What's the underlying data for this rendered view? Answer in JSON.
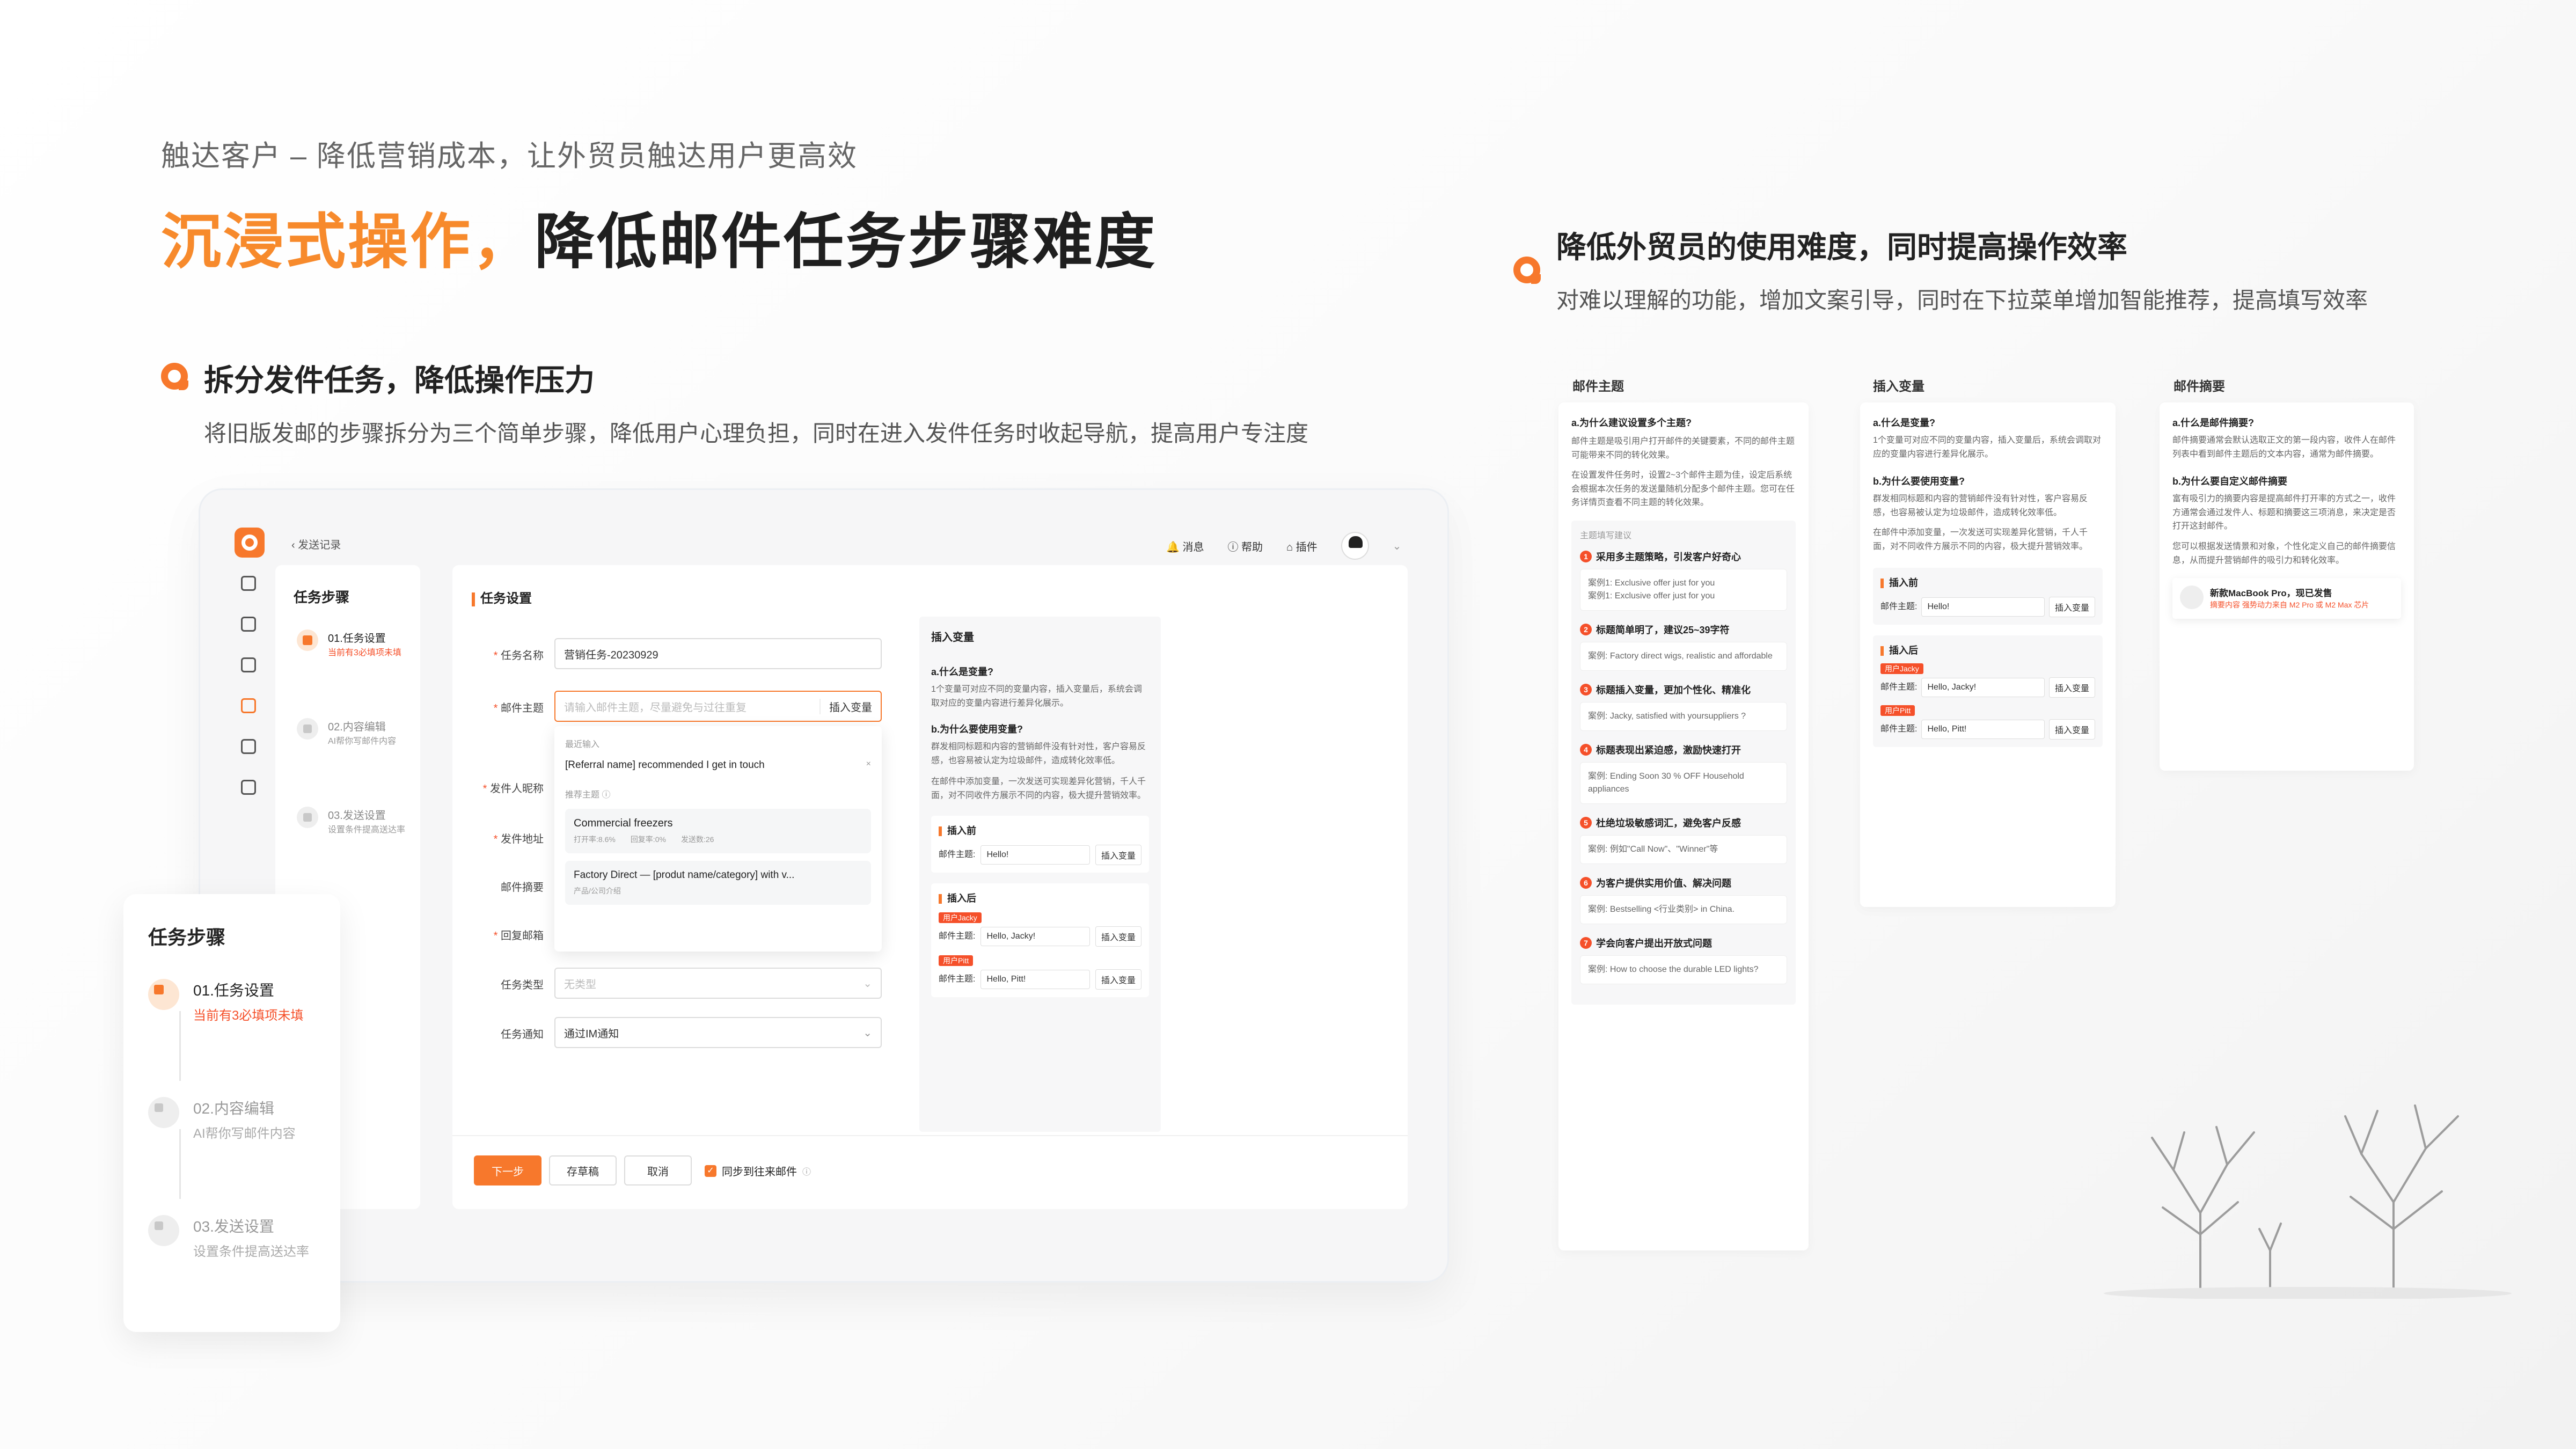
{
  "hero": {
    "eyebrow": "触达客户 – 降低营销成本，让外贸员触达用户更高效",
    "title_highlight": "沉浸式操作，",
    "title_rest": "降低邮件任务步骤难度"
  },
  "section_left": {
    "title": "拆分发件任务，降低操作压力",
    "desc": "将旧版发邮的步骤拆分为三个简单步骤，降低用户心理负担，同时在进入发件任务时收起导航，提高用户专注度"
  },
  "section_right": {
    "title": "降低外贸员的使用难度，同时提高操作效率",
    "desc": "对难以理解的功能，增加文案引导，同时在下拉菜单增加智能推荐，提高填写效率"
  },
  "app": {
    "back_label": "发送记录",
    "nav": {
      "messages": "消息",
      "help": "帮助",
      "plugins": "插件"
    },
    "steps_title": "任务步骤",
    "steps": [
      {
        "title": "01.任务设置",
        "sub": "当前有3必填项未填"
      },
      {
        "title": "02.内容编辑",
        "sub": "AI帮你写邮件内容"
      },
      {
        "title": "03.发送设置",
        "sub": "设置条件提高送达率"
      }
    ],
    "form_title": "任务设置",
    "fields": {
      "task_name_label": "任务名称",
      "task_name_value": "营销任务-20230929",
      "subject_label": "邮件主题",
      "subject_placeholder": "请输入邮件主题，尽量避免与过往重复",
      "insert_var": "插入变量",
      "sender_label": "发件人昵称",
      "sender_addr_label": "发件地址",
      "summary_label": "邮件摘要",
      "reply_label": "回复邮箱",
      "type_label": "任务类型",
      "type_placeholder": "无类型",
      "notify_label": "任务通知",
      "notify_value": "通过IM通知"
    },
    "dropdown": {
      "recent_label": "最近输入",
      "recent_item": "[Referral name] recommended I get in touch",
      "close": "×",
      "recommend_label": "推荐主题",
      "items": [
        {
          "title": "Commercial freezers",
          "meta": [
            "打开率:8.6%",
            "回复率:0%",
            "发送数:26"
          ]
        },
        {
          "title": "Factory Direct — [produt name/category] with v...",
          "meta": [
            "产品/公司介绍"
          ]
        }
      ]
    },
    "help_panel": {
      "title": "插入变量",
      "q1": "a.什么是变量?",
      "a1": "1个变量可对应不同的变量内容，插入变量后，系统会调取对应的变量内容进行差异化展示。",
      "q2": "b.为什么要使用变量?",
      "a2": "群发相同标题和内容的营销邮件没有针对性，客户容易反感，也容易被认定为垃圾邮件，造成转化效率低。",
      "a3": "在邮件中添加变量，一次发送可实现差异化营销，千人千面，对不同收件方展示不同的内容，极大提升营销效率。",
      "before_title": "插入前",
      "after_title": "插入后",
      "subject_label": "邮件主题:",
      "hello": "Hello!",
      "tag1": "用户Jacky",
      "hello_jacky": "Hello, Jacky!",
      "tag2": "用户Pitt",
      "hello_pitt": "Hello, Pitt!"
    },
    "buttons": {
      "next": "下一步",
      "draft": "存草稿",
      "cancel": "取消",
      "sync": "同步到往来邮件"
    }
  },
  "floating_steps": {
    "title": "任务步骤",
    "steps": [
      {
        "title": "01.任务设置",
        "sub": "当前有3必填项未填"
      },
      {
        "title": "02.内容编辑",
        "sub": "AI帮你写邮件内容"
      },
      {
        "title": "03.发送设置",
        "sub": "设置条件提高送达率"
      }
    ]
  },
  "cards": {
    "subject": {
      "head": "邮件主题",
      "q": "a.为什么建议设置多个主题?",
      "p1": "邮件主题是吸引用户打开邮件的关键要素，不同的邮件主题可能带来不同的转化效果。",
      "p2": "在设置发件任务时，设置2~3个邮件主题为佳，设定后系统会根据本次任务的发送量随机分配多个邮件主题。您可在任务详情页查看不同主题的转化效果。",
      "tips_label": "主题填写建议",
      "tips": [
        {
          "n": "1",
          "title": "采用多主题策略，引发客户好奇心",
          "cases": [
            "案例1: Exclusive offer just for you",
            "案例1: Exclusive offer just for you"
          ]
        },
        {
          "n": "2",
          "title": "标题简单明了，建议25~39字符",
          "cases": [
            "案例: Factory direct wigs, realistic and affordable"
          ]
        },
        {
          "n": "3",
          "title": "标题插入变量，更加个性化、精准化",
          "cases": [
            "案例: Jacky, satisfied with yoursuppliers ?"
          ]
        },
        {
          "n": "4",
          "title": "标题表现出紧迫感，激励快速打开",
          "cases": [
            "案例: Ending Soon 30 % OFF Household appliances"
          ]
        },
        {
          "n": "5",
          "title": "杜绝垃圾敏感词汇，避免客户反感",
          "cases": [
            "案例: 例如\"Call Now\"、\"Winner\"等"
          ]
        },
        {
          "n": "6",
          "title": "为客户提供实用价值、解决问题",
          "cases": [
            "案例: Bestselling <行业类别> in China."
          ]
        },
        {
          "n": "7",
          "title": "学会向客户提出开放式问题",
          "cases": [
            "案例: How to choose the durable LED lights?"
          ]
        }
      ]
    },
    "variable": {
      "head": "插入变量",
      "q1": "a.什么是变量?",
      "a1": "1个变量可对应不同的变量内容，插入变量后，系统会调取对应的变量内容进行差异化展示。",
      "q2": "b.为什么要使用变量?",
      "a2": "群发相同标题和内容的营销邮件没有针对性，客户容易反感，也容易被认定为垃圾邮件，造成转化效率低。",
      "a3": "在邮件中添加变量，一次发送可实现差异化营销，千人千面，对不同收件方展示不同的内容，极大提升营销效率。",
      "before": "插入前",
      "after": "插入后",
      "subject_label": "邮件主题:",
      "hello": "Hello!",
      "insert": "插入变量",
      "tag1": "用户Jacky",
      "hello_jacky": "Hello, Jacky!",
      "tag2": "用户Pitt",
      "hello_pitt": "Hello, Pitt!"
    },
    "summary": {
      "head": "邮件摘要",
      "q1": "a.什么是邮件摘要?",
      "a1": "邮件摘要通常会默认选取正文的第一段内容，收件人在邮件列表中看到邮件主题后的文本内容，通常为邮件摘要。",
      "q2": "b.为什么要自定义邮件摘要",
      "a2": "富有吸引力的摘要内容是提高邮件打开率的方式之一，收件方通常会通过发件人、标题和摘要这三项消息，来决定是否打开这封邮件。",
      "a3": "您可以根据发送情景和对象，个性化定义自己的邮件摘要信息，从而提升营销邮件的吸引力和转化效率。",
      "preview_title": "新款MacBook Pro，现已发售",
      "preview_body": "摘要内容 强势动力来自 M2 Pro 或 M2 Max 芯片"
    }
  },
  "colors": {
    "accent": "#f7782c",
    "tag": "#f5502a"
  }
}
